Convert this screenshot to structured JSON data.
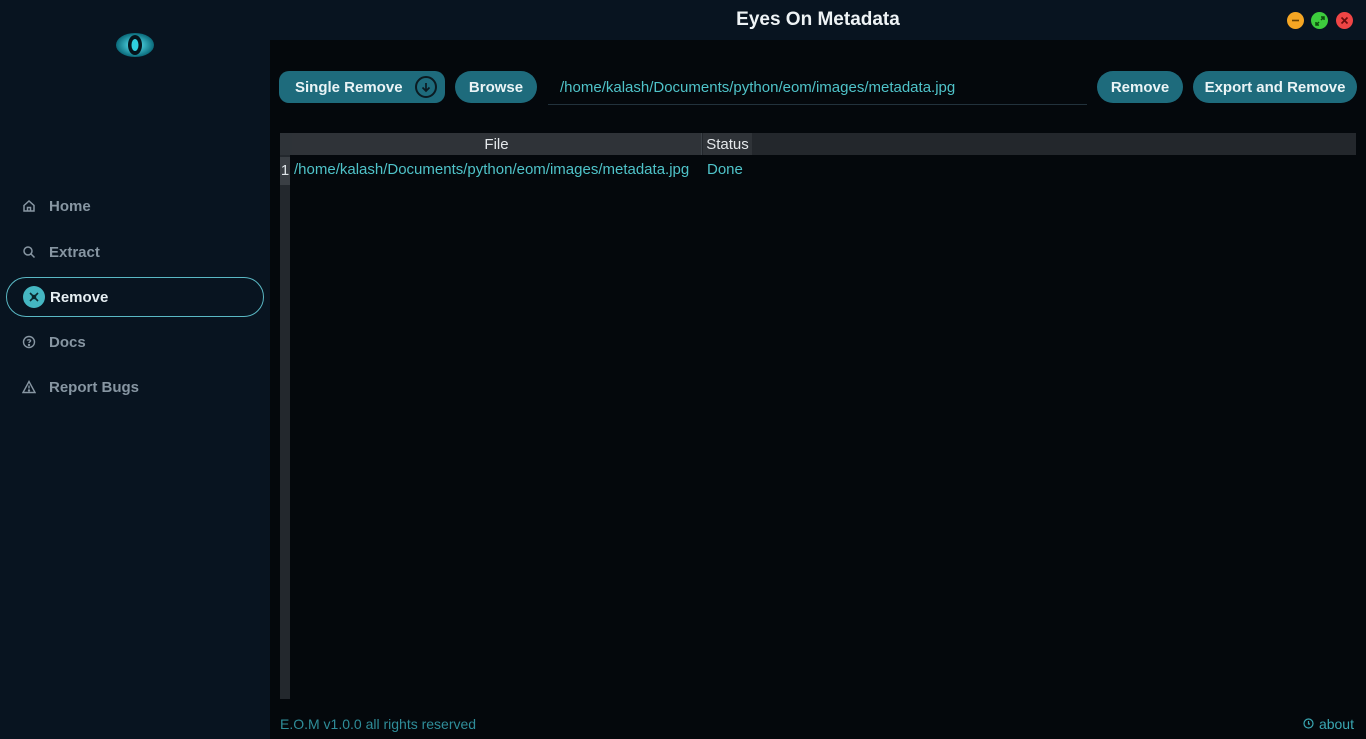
{
  "window": {
    "title": "Eyes On Metadata"
  },
  "sidebar": {
    "logo_icon": "eye-icon",
    "items": [
      {
        "label": "Home",
        "icon": "home-icon"
      },
      {
        "label": "Extract",
        "icon": "search-icon"
      },
      {
        "label": "Remove",
        "icon": "remove-icon",
        "active": true
      },
      {
        "label": "Docs",
        "icon": "help-circle-icon"
      },
      {
        "label": "Report Bugs",
        "icon": "warning-icon"
      }
    ]
  },
  "toolbar": {
    "mode_label": "Single Remove",
    "browse_label": "Browse",
    "path_value": "/home/kalash/Documents/python/eom/images/metadata.jpg",
    "remove_label": "Remove",
    "export_label": "Export and Remove"
  },
  "table": {
    "columns": [
      "File",
      "Status"
    ],
    "rows": [
      {
        "num": "1",
        "file": "/home/kalash/Documents/python/eom/images/metadata.jpg",
        "status": "Done"
      }
    ]
  },
  "footer": {
    "copyright": "E.O.M v1.0.0 all rights reserved",
    "about_label": "about"
  },
  "colors": {
    "accent": "#1e6b7c",
    "text_accent": "#4fc3c9",
    "sidebar_bg": "#081420",
    "body_bg": "#04080c"
  }
}
